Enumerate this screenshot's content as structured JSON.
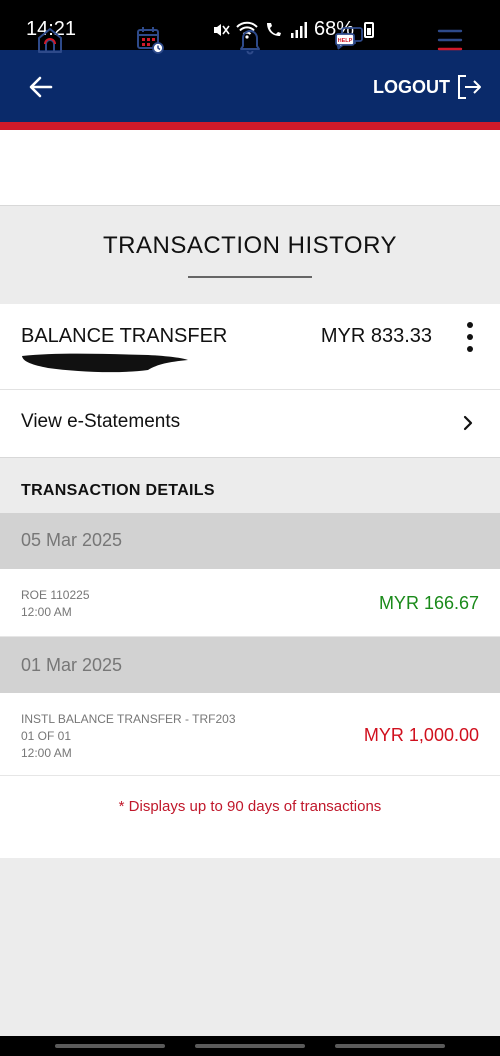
{
  "status_bar": {
    "time": "14:21",
    "battery_percent": "68%",
    "icons": [
      "mute-icon",
      "wifi-icon",
      "wifi-calling-icon",
      "signal-icon",
      "battery-icon"
    ]
  },
  "header": {
    "back_icon": "arrow-left-icon",
    "logout_label": "LOGOUT",
    "logout_icon": "logout-icon",
    "colors": {
      "background": "#0a2a6a",
      "accent": "#d11a2a"
    }
  },
  "nav": {
    "items": [
      {
        "icon": "home-icon"
      },
      {
        "icon": "calendar-clock-icon"
      },
      {
        "icon": "bell-icon"
      },
      {
        "icon": "help-chat-icon",
        "badge_text": "HELP"
      },
      {
        "icon": "hamburger-menu-icon"
      }
    ]
  },
  "page": {
    "title": "TRANSACTION HISTORY"
  },
  "account": {
    "name": "BALANCE TRANSFER",
    "balance": "MYR 833.33"
  },
  "estatements": {
    "label": "View e-Statements"
  },
  "transactions": {
    "section_title": "TRANSACTION DETAILS",
    "groups": [
      {
        "date": "05 Mar 2025",
        "items": [
          {
            "lines": [
              "ROE 110225",
              "12:00 AM"
            ],
            "amount": "MYR 166.67",
            "type": "credit"
          }
        ]
      },
      {
        "date": "01 Mar 2025",
        "items": [
          {
            "lines": [
              "INSTL BALANCE TRANSFER - TRF203",
              "01 OF 01",
              "12:00 AM"
            ],
            "amount": "MYR 1,000.00",
            "type": "debit"
          }
        ]
      }
    ],
    "colors": {
      "credit": "#1a8a1a",
      "debit": "#d0101e"
    }
  },
  "footer_note": "* Displays up to 90 days of transactions"
}
